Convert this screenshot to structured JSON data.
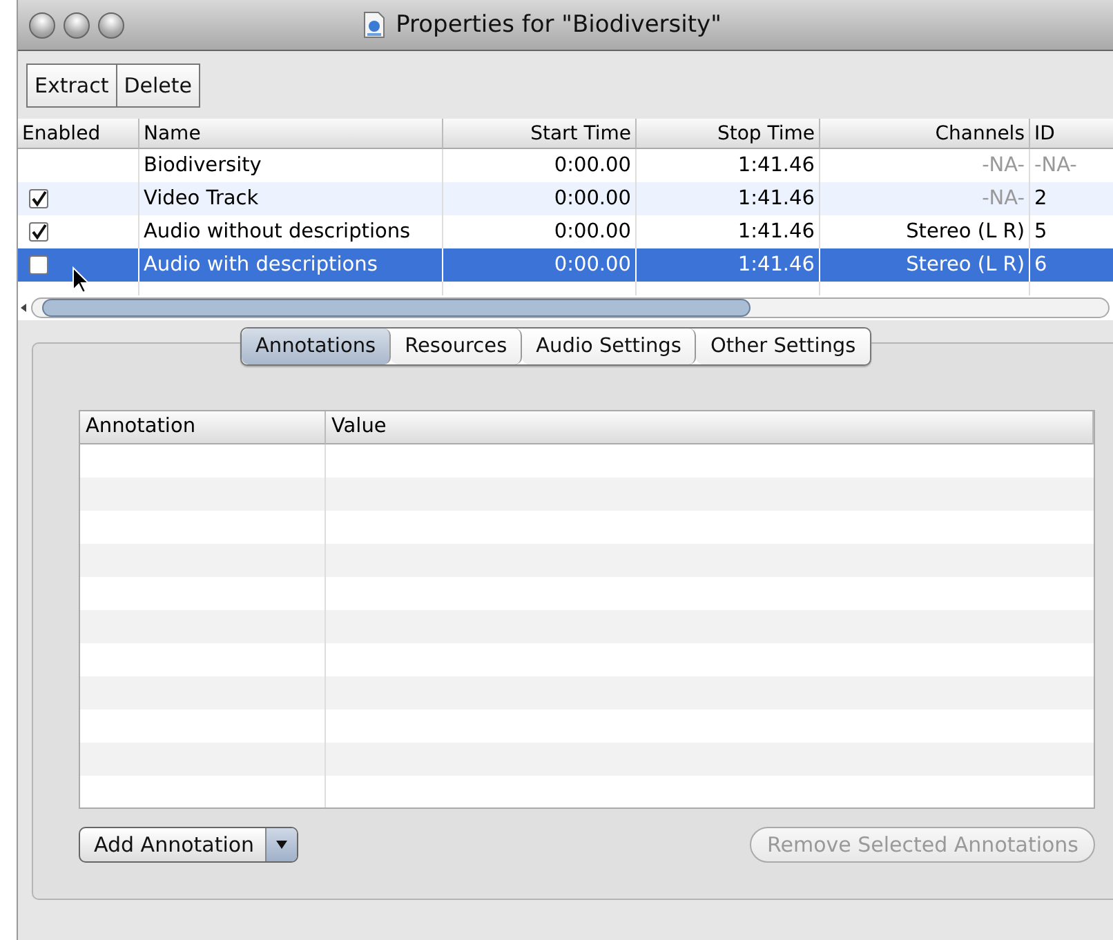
{
  "window": {
    "title": "Properties for \"Biodiversity\""
  },
  "toolbar": {
    "buttons": [
      "Extract",
      "Delete"
    ]
  },
  "tracks": {
    "columns": [
      "Enabled",
      "Name",
      "Start Time",
      "Stop Time",
      "Channels",
      "ID"
    ],
    "rows": [
      {
        "name": "Biodiversity",
        "start": "0:00.00",
        "stop": "1:41.46",
        "channels": {
          "text": "-NA-",
          "dimmed": true
        },
        "id": {
          "text": "-NA-",
          "dimmed": true
        },
        "selected": false
      },
      {
        "enabled": true,
        "name": "Video Track",
        "start": "0:00.00",
        "stop": "1:41.46",
        "channels": {
          "text": "-NA-",
          "dimmed": true
        },
        "id": {
          "text": "2",
          "dimmed": false
        },
        "selected": false
      },
      {
        "enabled": true,
        "name": "Audio without descriptions",
        "start": "0:00.00",
        "stop": "1:41.46",
        "channels": {
          "text": "Stereo (L R)",
          "dimmed": false
        },
        "id": {
          "text": "5",
          "dimmed": false
        },
        "selected": false
      },
      {
        "enabled": false,
        "name": "Audio with descriptions",
        "start": "0:00.00",
        "stop": "1:41.46",
        "channels": {
          "text": "Stereo (L R)",
          "dimmed": false
        },
        "id": {
          "text": "6",
          "dimmed": false
        },
        "selected": true
      }
    ]
  },
  "tabs": [
    {
      "label": "Annotations",
      "selected": true
    },
    {
      "label": "Resources",
      "selected": false
    },
    {
      "label": "Audio Settings",
      "selected": false
    },
    {
      "label": "Other Settings",
      "selected": false
    }
  ],
  "annotations": {
    "columns": [
      "Annotation",
      "Value"
    ]
  },
  "buttons": [
    {
      "label": "Add Annotation",
      "kind": "menu",
      "disabled": false
    },
    {
      "label": "Remove Selected Annotations",
      "kind": "push",
      "disabled": true
    }
  ]
}
